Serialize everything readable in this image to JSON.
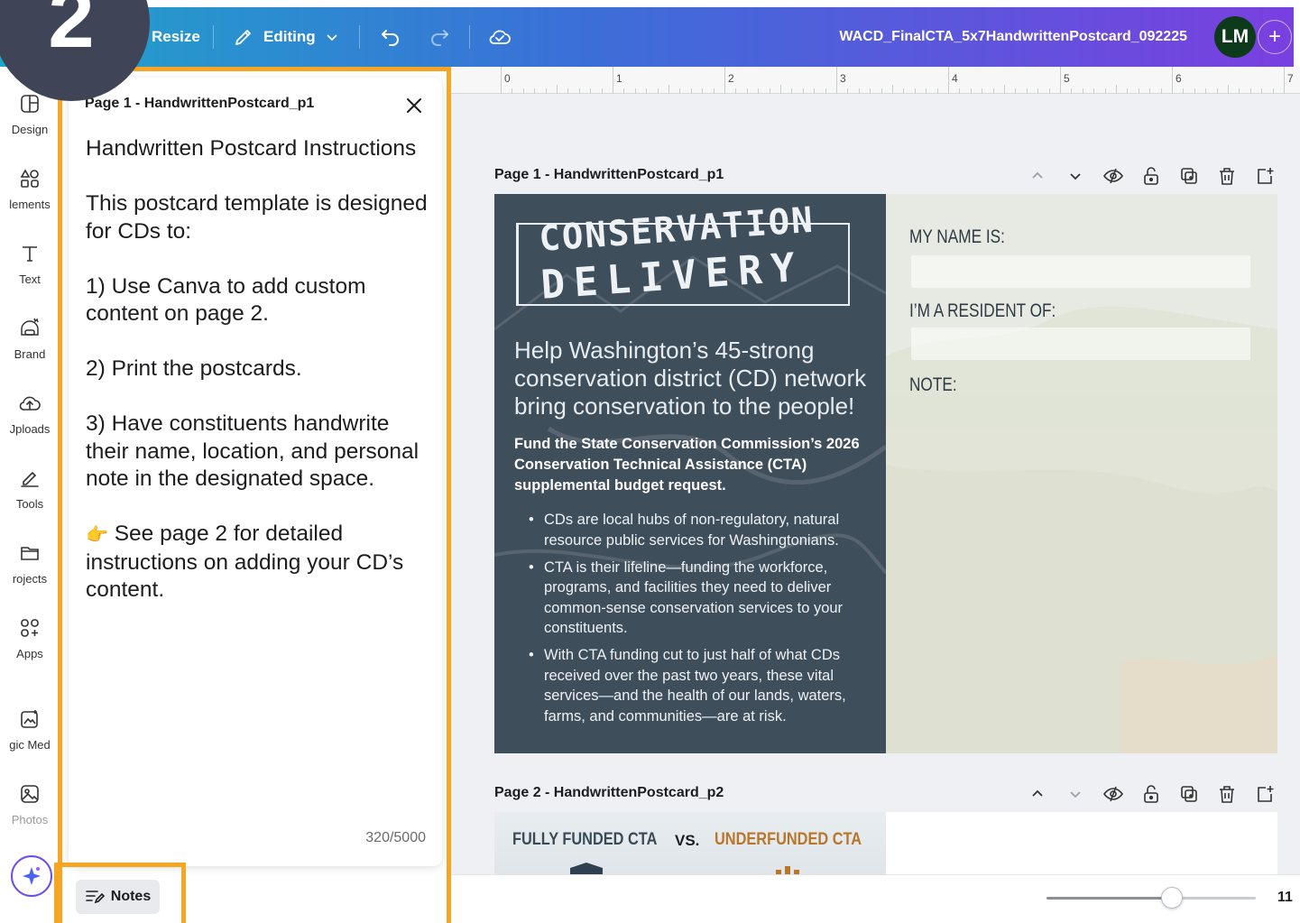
{
  "topbar": {
    "resize_label": "Resize",
    "mode_label": "Editing",
    "doc_title": "WACD_FinalCTA_5x7HandwrittenPostcard_092225",
    "avatar_initials": "LM",
    "add_label": "+",
    "step_number": "2",
    "gradient": [
      "#1fa6c9",
      "#3b6fd8",
      "#7a3fe0"
    ]
  },
  "sidebar": {
    "items": [
      {
        "label": "Design",
        "icon": "layout-icon"
      },
      {
        "label": "lements",
        "icon": "elements-icon"
      },
      {
        "label": "Text",
        "icon": "text-icon"
      },
      {
        "label": "Brand",
        "icon": "brand-icon"
      },
      {
        "label": "Jploads",
        "icon": "upload-icon"
      },
      {
        "label": "Tools",
        "icon": "pen-icon"
      },
      {
        "label": "rojects",
        "icon": "folder-icon"
      },
      {
        "label": "Apps",
        "icon": "apps-icon"
      },
      {
        "label": "gic Med",
        "icon": "magic-media-icon"
      },
      {
        "label": "Photos",
        "icon": "photo-icon"
      }
    ]
  },
  "notes": {
    "page_header": "Page 1 - HandwrittenPostcard_p1",
    "paragraphs": [
      "Handwritten Postcard Instructions",
      "This postcard template is designed for CDs to:",
      "1) Use Canva to add custom content on page 2.",
      "2) Print the postcards.",
      "3) Have constituents handwrite their name, location, and personal note in the designated space.",
      "See page 2 for detailed instructions on adding your CD’s content."
    ],
    "pointer_emoji": "👉",
    "char_count": "320/5000",
    "button_label": "Notes",
    "highlight_color": "#f6a623"
  },
  "ruler": {
    "numbers": [
      "0",
      "1",
      "2",
      "3",
      "4",
      "5",
      "6",
      "7"
    ]
  },
  "pages": [
    {
      "label": "Page 1 - HandwrittenPostcard_p1"
    },
    {
      "label": "Page 2 - HandwrittenPostcard_p2"
    }
  ],
  "postcard": {
    "logo_line1": "CONSERVATION",
    "logo_line2": "DELIVERY",
    "headline": "Help Washington’s 45-strong conservation district (CD) network bring conservation to the people!",
    "fund_text": "Fund the State Conservation Commission’s 2026 Conservation Technical Assistance (CTA) supplemental budget request.",
    "bullets": [
      "CDs are local hubs of non-regulatory, natural resource public services for Washingtonians.",
      "CTA is their lifeline—funding the workforce, programs, and facilities they need to deliver common-sense conservation services to your constituents.",
      "With CTA funding cut to just half of what CDs received over the past two years, these vital services—and the health of our lands, waters, farms, and communities—are at risk."
    ],
    "field_name": "MY NAME IS:",
    "field_resident": "I’M A RESIDENT OF:",
    "field_note": "NOTE:",
    "panel_color": "#3f4e5b"
  },
  "page2": {
    "left_title": "FULLY FUNDED CTA",
    "vs": "VS.",
    "right_title": "UNDERFUNDED CTA"
  },
  "zoom": {
    "value": "11",
    "level_fraction": 0.6
  }
}
